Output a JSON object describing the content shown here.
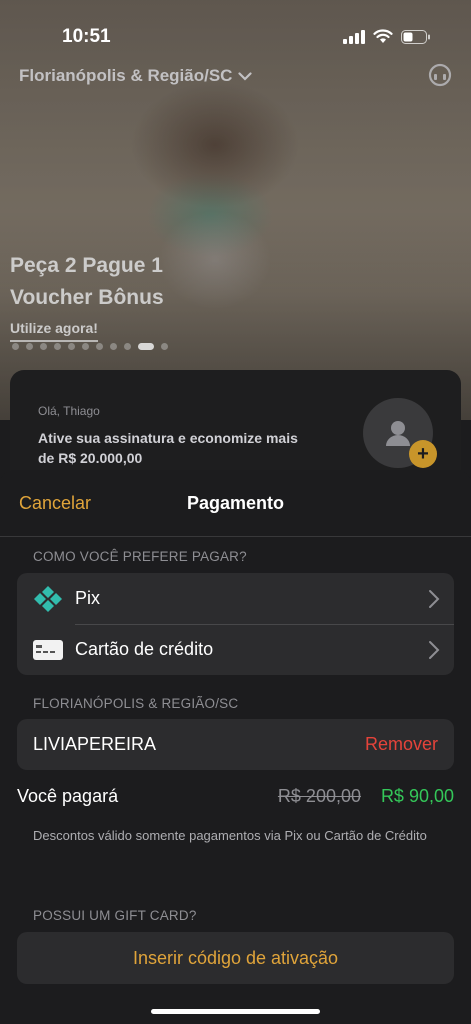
{
  "status_bar": {
    "time": "10:51"
  },
  "hero": {
    "location": "Florianópolis & Região/SC",
    "promo_line1": "Peça 2 Pague 1",
    "promo_line2": "Voucher Bônus",
    "promo_cta": "Utilize agora!",
    "carousel_count": 11,
    "carousel_active_index": 9
  },
  "greeting": {
    "name": "Olá, Thiago",
    "message": "Ative sua assinatura e economize mais de  R$ 20.000,00"
  },
  "sheet": {
    "cancel_label": "Cancelar",
    "title": "Pagamento",
    "payment_section_label": "COMO VOCÊ PREFERE PAGAR?",
    "payment_methods": [
      {
        "label": "Pix",
        "icon": "pix-icon"
      },
      {
        "label": "Cartão de crédito",
        "icon": "credit-card-icon"
      }
    ],
    "region_section_label": "FLORIANÓPOLIS & REGIÃO/SC",
    "coupon_code": "LIVIAPEREIRA",
    "remove_label": "Remover",
    "you_pay_label": "Você pagará",
    "old_price": "R$ 200,00",
    "new_price": "R$ 90,00",
    "disclaimer": "Descontos válido somente pagamentos via Pix ou Cartão de Crédito",
    "gift_section_label": "POSSUI UM GIFT CARD?",
    "gift_button_label": "Inserir código de ativação"
  },
  "colors": {
    "accent": "#e0a43a",
    "danger": "#e5433a",
    "success": "#34c759",
    "pix": "#32bcad"
  }
}
